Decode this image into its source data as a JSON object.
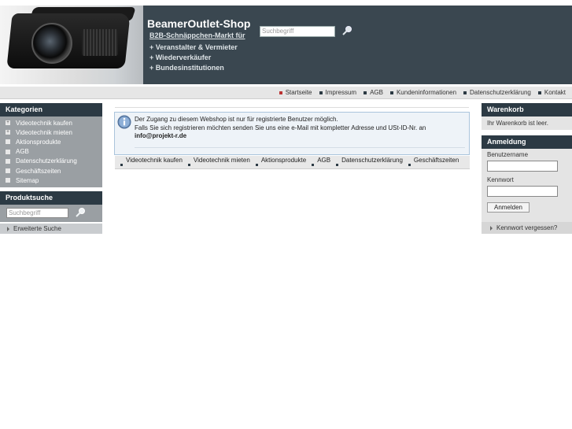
{
  "header": {
    "title": "BeamerOutlet-Shop",
    "tagline": "B2B-Schnäppchen-Markt für",
    "lines": [
      "+ Veranstalter & Vermieter",
      "+ Wiederverkäufer",
      "+ Bundesinstitutionen"
    ],
    "search_placeholder": "Suchbegriff"
  },
  "topnav": {
    "items": [
      "Startseite",
      "Impressum",
      "AGB",
      "Kundeninformationen",
      "Datenschutzerklärung",
      "Kontakt"
    ]
  },
  "left": {
    "categories_title": "Kategorien",
    "categories": [
      {
        "label": "Videotechnik kaufen",
        "marker": "+"
      },
      {
        "label": "Videotechnik mieten",
        "marker": "+"
      },
      {
        "label": "Aktionsprodukte",
        "marker": ""
      },
      {
        "label": "AGB",
        "marker": ""
      },
      {
        "label": "Datenschutzerklärung",
        "marker": ""
      },
      {
        "label": "Geschäftszeiten",
        "marker": ""
      },
      {
        "label": "Sitemap",
        "marker": ""
      }
    ],
    "search_title": "Produktsuche",
    "search_placeholder": "Suchbegriff",
    "advanced_search": "Erweiterte Suche"
  },
  "main": {
    "notice_line1": "Der Zugang zu diesem Webshop ist nur für registrierte Benutzer möglich.",
    "notice_line2": "Falls Sie sich registrieren möchten senden Sie uns eine e-Mail mit kompletter Adresse und USt-ID-Nr. an",
    "notice_email": "info@projekt-r.de",
    "bottom_nav": [
      "Videotechnik kaufen",
      "Videotechnik mieten",
      "Aktionsprodukte",
      "AGB",
      "Datenschutzerklärung",
      "Geschäftszeiten"
    ]
  },
  "right": {
    "cart_title": "Warenkorb",
    "cart_empty": "Ihr Warenkorb ist leer.",
    "login_title": "Anmeldung",
    "username_label": "Benutzername",
    "password_label": "Kennwort",
    "login_button": "Anmelden",
    "forgot_password": "Kennwort vergessen?"
  }
}
